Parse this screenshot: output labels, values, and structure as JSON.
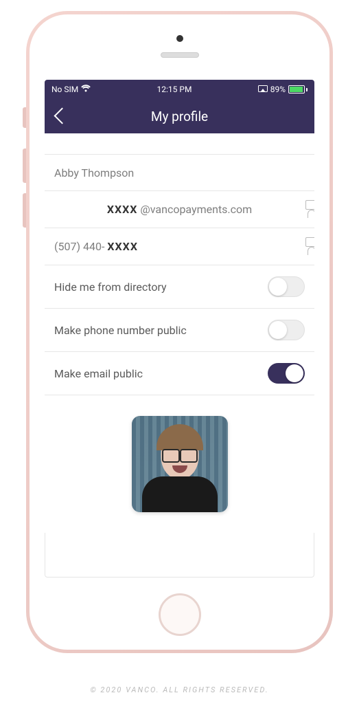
{
  "status_bar": {
    "carrier": "No SIM",
    "time": "12:15 PM",
    "battery_pct": "89%"
  },
  "nav": {
    "title": "My profile"
  },
  "profile": {
    "name": "Abby Thompson",
    "email_mask": "XXXX",
    "email_domain": "@vancopayments.com",
    "phone_prefix": "(507) 440-",
    "phone_mask": "XXXX"
  },
  "settings": {
    "hide_label": "Hide me from directory",
    "hide_on": false,
    "phone_public_label": "Make phone number public",
    "phone_public_on": false,
    "email_public_label": "Make email public",
    "email_public_on": true
  },
  "footer": "© 2020 VANCO. ALL RIGHTS RESERVED."
}
